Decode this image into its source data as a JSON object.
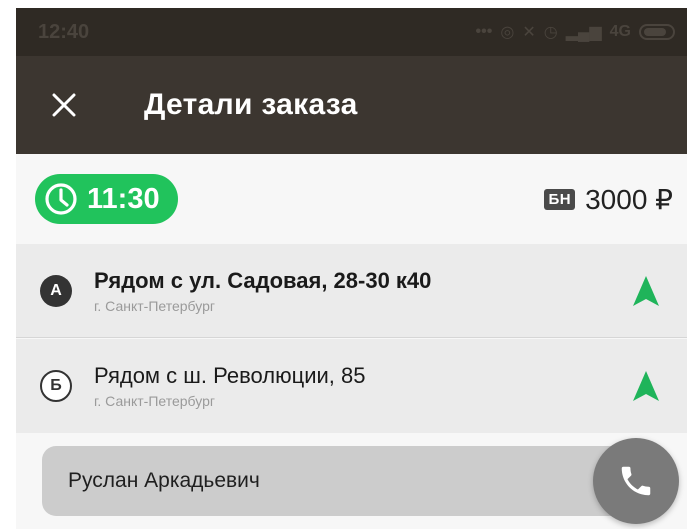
{
  "status_bar": {
    "time": "12:40",
    "network": "4G"
  },
  "toolbar": {
    "close_icon": "close-icon",
    "title": "Детали заказа"
  },
  "order": {
    "time": "11:30",
    "payment_badge": "БН",
    "price": "3000 ₽"
  },
  "route": [
    {
      "marker": "А",
      "address": "Рядом с ул. Садовая, 28-30 к40",
      "city": "г. Санкт-Петербург"
    },
    {
      "marker": "Б",
      "address": "Рядом с ш. Революции, 85",
      "city": "г. Санкт-Петербург"
    }
  ],
  "contact": {
    "name": "Руслан Аркадьевич",
    "call_icon": "phone-icon"
  },
  "colors": {
    "toolbar": "#3c3630",
    "accent_green": "#21c35c",
    "nav_arrow": "#1fb45a"
  }
}
